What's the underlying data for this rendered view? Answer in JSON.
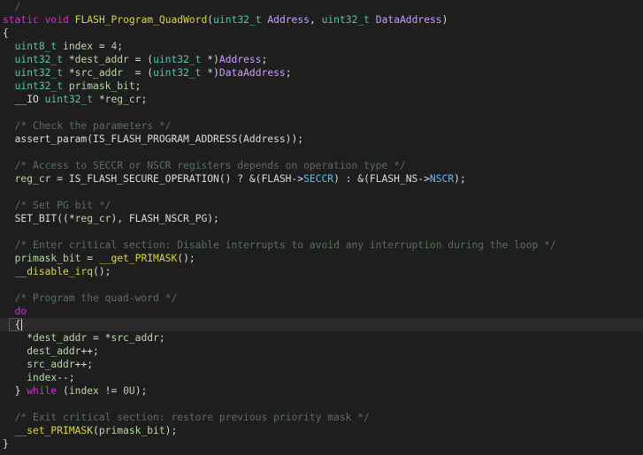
{
  "editor": {
    "current_line_index": 24,
    "lines": [
      {
        "tokens": [
          {
            "t": "  /",
            "c": "cmt"
          }
        ]
      },
      {
        "tokens": [
          {
            "t": "static",
            "c": "kw"
          },
          {
            "t": " ",
            "c": "pl"
          },
          {
            "t": "void",
            "c": "kw"
          },
          {
            "t": " ",
            "c": "pl"
          },
          {
            "t": "FLASH_Program_QuadWord",
            "c": "fn"
          },
          {
            "t": "(",
            "c": "pl"
          },
          {
            "t": "uint32_t",
            "c": "ty"
          },
          {
            "t": " ",
            "c": "pl"
          },
          {
            "t": "Address",
            "c": "vr"
          },
          {
            "t": ", ",
            "c": "pl"
          },
          {
            "t": "uint32_t",
            "c": "ty"
          },
          {
            "t": " ",
            "c": "pl"
          },
          {
            "t": "DataAddress",
            "c": "vr"
          },
          {
            "t": ")",
            "c": "pl"
          }
        ]
      },
      {
        "tokens": [
          {
            "t": "{",
            "c": "pl"
          }
        ]
      },
      {
        "tokens": [
          {
            "t": "  ",
            "c": "pl"
          },
          {
            "t": "uint8_t",
            "c": "ty"
          },
          {
            "t": " ",
            "c": "pl"
          },
          {
            "t": "index",
            "c": "id"
          },
          {
            "t": " = ",
            "c": "pl"
          },
          {
            "t": "4",
            "c": "num"
          },
          {
            "t": ";",
            "c": "pl"
          }
        ]
      },
      {
        "tokens": [
          {
            "t": "  ",
            "c": "pl"
          },
          {
            "t": "uint32_t",
            "c": "ty"
          },
          {
            "t": " *",
            "c": "pl"
          },
          {
            "t": "dest_addr",
            "c": "id"
          },
          {
            "t": " = (",
            "c": "pl"
          },
          {
            "t": "uint32_t",
            "c": "ty"
          },
          {
            "t": " *)",
            "c": "pl"
          },
          {
            "t": "Address",
            "c": "vr"
          },
          {
            "t": ";",
            "c": "pl"
          }
        ]
      },
      {
        "tokens": [
          {
            "t": "  ",
            "c": "pl"
          },
          {
            "t": "uint32_t",
            "c": "ty"
          },
          {
            "t": " *",
            "c": "pl"
          },
          {
            "t": "src_addr",
            "c": "id"
          },
          {
            "t": "  = (",
            "c": "pl"
          },
          {
            "t": "uint32_t",
            "c": "ty"
          },
          {
            "t": " *)",
            "c": "pl"
          },
          {
            "t": "DataAddress",
            "c": "vr"
          },
          {
            "t": ";",
            "c": "pl"
          }
        ]
      },
      {
        "tokens": [
          {
            "t": "  ",
            "c": "pl"
          },
          {
            "t": "uint32_t",
            "c": "ty"
          },
          {
            "t": " ",
            "c": "pl"
          },
          {
            "t": "primask_bit",
            "c": "id"
          },
          {
            "t": ";",
            "c": "pl"
          }
        ]
      },
      {
        "tokens": [
          {
            "t": "  ",
            "c": "pl"
          },
          {
            "t": "__IO",
            "c": "pl"
          },
          {
            "t": " ",
            "c": "pl"
          },
          {
            "t": "uint32_t",
            "c": "ty"
          },
          {
            "t": " *",
            "c": "pl"
          },
          {
            "t": "reg_cr",
            "c": "id"
          },
          {
            "t": ";",
            "c": "pl"
          }
        ]
      },
      {
        "tokens": []
      },
      {
        "tokens": [
          {
            "t": "  ",
            "c": "pl"
          },
          {
            "t": "/* Check the parameters */",
            "c": "cmt"
          }
        ]
      },
      {
        "tokens": [
          {
            "t": "  ",
            "c": "pl"
          },
          {
            "t": "assert_param(IS_FLASH_PROGRAM_ADDRESS(Address));",
            "c": "pl"
          }
        ]
      },
      {
        "tokens": []
      },
      {
        "tokens": [
          {
            "t": "  ",
            "c": "pl"
          },
          {
            "t": "/* Access to SECCR or NSCR registers depends on operation type */",
            "c": "cmt"
          }
        ]
      },
      {
        "tokens": [
          {
            "t": "  ",
            "c": "pl"
          },
          {
            "t": "reg_cr",
            "c": "id"
          },
          {
            "t": " = IS_FLASH_SECURE_OPERATION() ? &(FLASH->",
            "c": "pl"
          },
          {
            "t": "SECCR",
            "c": "fld"
          },
          {
            "t": ") : &(FLASH_NS->",
            "c": "pl"
          },
          {
            "t": "NSCR",
            "c": "fld"
          },
          {
            "t": ");",
            "c": "pl"
          }
        ]
      },
      {
        "tokens": []
      },
      {
        "tokens": [
          {
            "t": "  ",
            "c": "pl"
          },
          {
            "t": "/* Set PG bit */",
            "c": "cmt"
          }
        ]
      },
      {
        "tokens": [
          {
            "t": "  ",
            "c": "pl"
          },
          {
            "t": "SET_BIT((*",
            "c": "pl"
          },
          {
            "t": "reg_cr",
            "c": "id"
          },
          {
            "t": "), FLASH_NSCR_PG);",
            "c": "pl"
          }
        ]
      },
      {
        "tokens": []
      },
      {
        "tokens": [
          {
            "t": "  ",
            "c": "pl"
          },
          {
            "t": "/* Enter critical section: Disable interrupts to avoid any interruption during the loop */",
            "c": "cmt"
          }
        ]
      },
      {
        "tokens": [
          {
            "t": "  ",
            "c": "pl"
          },
          {
            "t": "primask_bit",
            "c": "id"
          },
          {
            "t": " = ",
            "c": "pl"
          },
          {
            "t": "__get_PRIMASK",
            "c": "fn"
          },
          {
            "t": "();",
            "c": "pl"
          }
        ]
      },
      {
        "tokens": [
          {
            "t": "  ",
            "c": "pl"
          },
          {
            "t": "__disable_irq",
            "c": "fn"
          },
          {
            "t": "();",
            "c": "pl"
          }
        ]
      },
      {
        "tokens": []
      },
      {
        "tokens": [
          {
            "t": "  ",
            "c": "pl"
          },
          {
            "t": "/* Program the quad-word */",
            "c": "cmt"
          }
        ]
      },
      {
        "tokens": [
          {
            "t": "  ",
            "c": "pl"
          },
          {
            "t": "do",
            "c": "kw"
          }
        ]
      },
      {
        "tokens": [
          {
            "t": "  ",
            "c": "pl"
          },
          {
            "t": "{",
            "c": "pl"
          }
        ]
      },
      {
        "tokens": [
          {
            "t": "    *",
            "c": "pl"
          },
          {
            "t": "dest_addr",
            "c": "id"
          },
          {
            "t": " = *",
            "c": "pl"
          },
          {
            "t": "src_addr",
            "c": "id"
          },
          {
            "t": ";",
            "c": "pl"
          }
        ]
      },
      {
        "tokens": [
          {
            "t": "    ",
            "c": "pl"
          },
          {
            "t": "dest_addr",
            "c": "id"
          },
          {
            "t": "++;",
            "c": "pl"
          }
        ]
      },
      {
        "tokens": [
          {
            "t": "    ",
            "c": "pl"
          },
          {
            "t": "src_addr",
            "c": "id"
          },
          {
            "t": "++;",
            "c": "pl"
          }
        ]
      },
      {
        "tokens": [
          {
            "t": "    ",
            "c": "pl"
          },
          {
            "t": "index",
            "c": "id"
          },
          {
            "t": "--;",
            "c": "pl"
          }
        ]
      },
      {
        "tokens": [
          {
            "t": "  } ",
            "c": "pl"
          },
          {
            "t": "while",
            "c": "kw"
          },
          {
            "t": " (",
            "c": "pl"
          },
          {
            "t": "index",
            "c": "id"
          },
          {
            "t": " != ",
            "c": "pl"
          },
          {
            "t": "0U",
            "c": "num"
          },
          {
            "t": ");",
            "c": "pl"
          }
        ]
      },
      {
        "tokens": []
      },
      {
        "tokens": [
          {
            "t": "  ",
            "c": "pl"
          },
          {
            "t": "/* Exit critical section: restore previous priority mask */",
            "c": "cmt"
          }
        ]
      },
      {
        "tokens": [
          {
            "t": "  ",
            "c": "pl"
          },
          {
            "t": "__set_PRIMASK",
            "c": "fn"
          },
          {
            "t": "(",
            "c": "pl"
          },
          {
            "t": "primask_bit",
            "c": "id"
          },
          {
            "t": ");",
            "c": "pl"
          }
        ]
      },
      {
        "tokens": [
          {
            "t": "}",
            "c": "pl"
          }
        ]
      }
    ]
  }
}
